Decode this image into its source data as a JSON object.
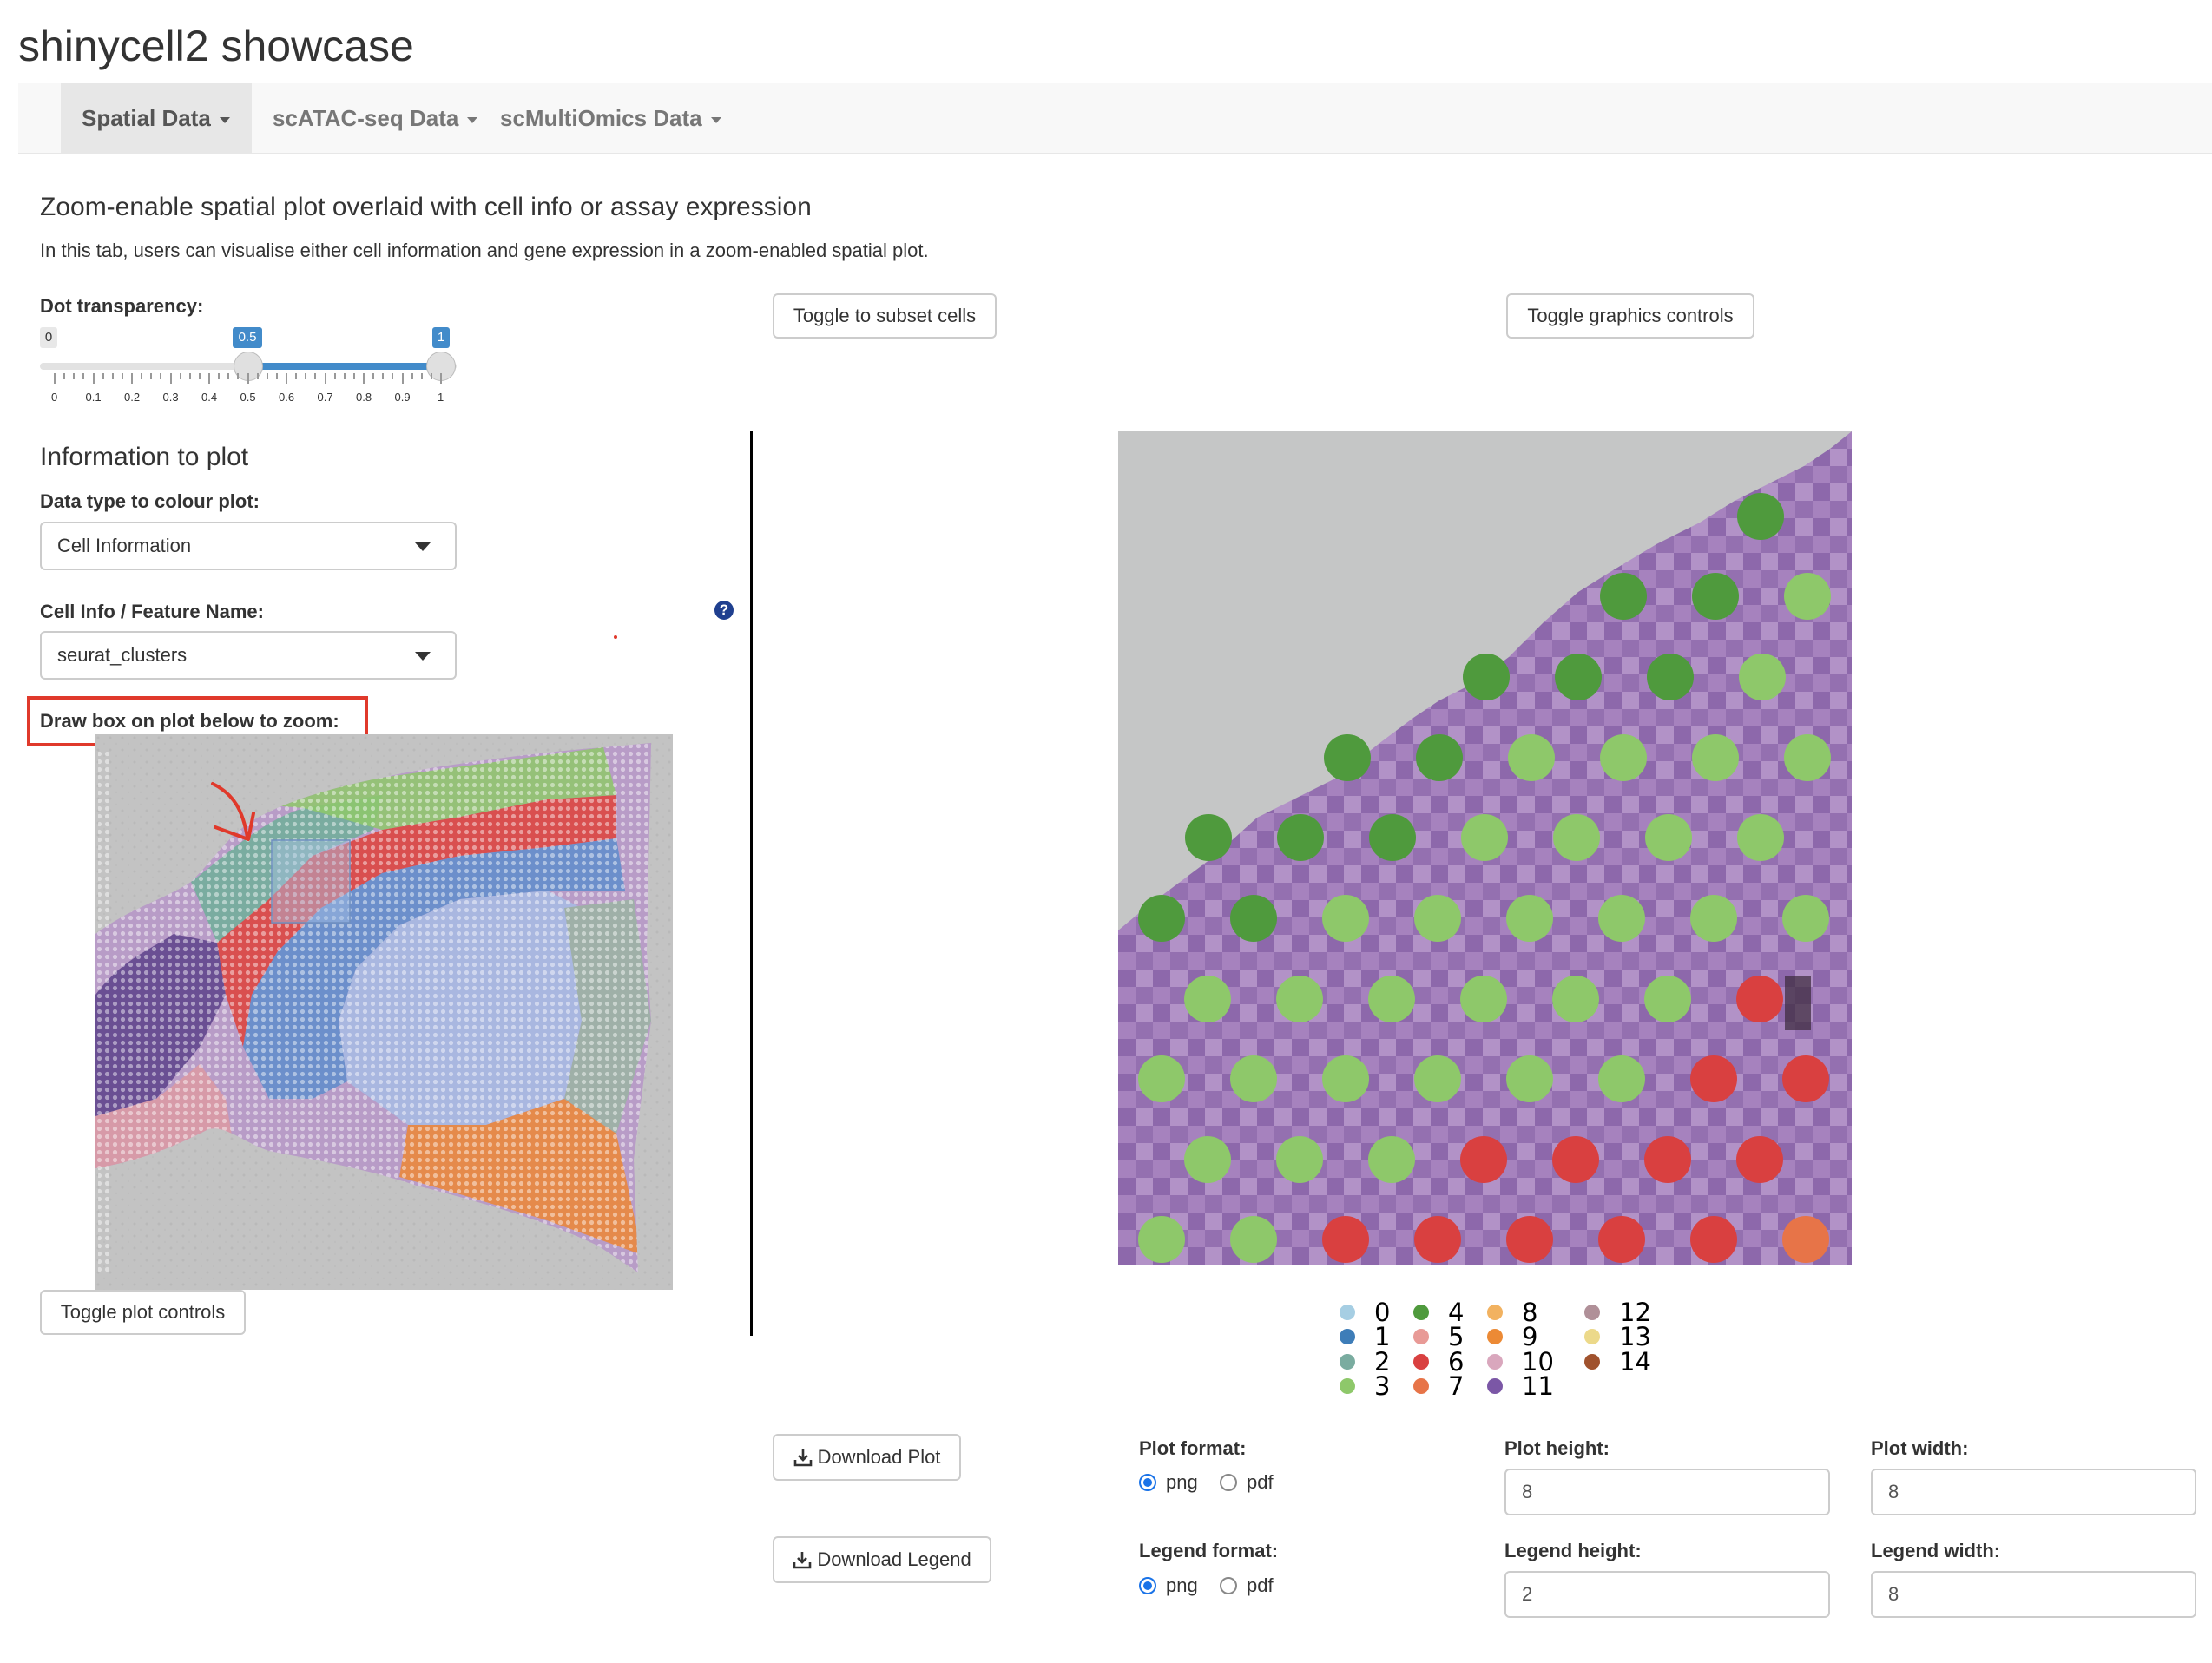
{
  "app": {
    "title": "shinycell2 showcase"
  },
  "nav": {
    "tabs": [
      {
        "label": "Spatial Data",
        "active": true
      },
      {
        "label": "scATAC-seq Data",
        "active": false
      },
      {
        "label": "scMultiOmics Data",
        "active": false
      }
    ]
  },
  "main": {
    "heading": "Zoom-enable spatial plot overlaid with cell info or assay expression",
    "description": "In this tab, users can visualise either cell information and gene expression in a zoom-enabled spatial plot."
  },
  "controls": {
    "transparency_label": "Dot transparency:",
    "slider": {
      "min_label": "0",
      "low_label": "0.5",
      "high_label": "1",
      "min": 0,
      "max": 1,
      "low": 0.5,
      "high": 1,
      "ticks": [
        "0",
        "0.1",
        "0.2",
        "0.3",
        "0.4",
        "0.5",
        "0.6",
        "0.7",
        "0.8",
        "0.9",
        "1"
      ]
    },
    "toggle_subset_label": "Toggle to subset cells",
    "toggle_graphics_label": "Toggle graphics controls",
    "info_heading": "Information to plot",
    "data_type_label": "Data type to colour plot:",
    "data_type_value": "Cell Information",
    "feature_label": "Cell Info / Feature Name:",
    "feature_value": "seurat_clusters",
    "help_icon_text": "?",
    "draw_box_label": "Draw box on plot below to zoom:",
    "toggle_plot_controls_label": "Toggle plot controls"
  },
  "legend": {
    "items": [
      {
        "label": "0",
        "color": "#a6cee3"
      },
      {
        "label": "1",
        "color": "#3e7db8"
      },
      {
        "label": "2",
        "color": "#7aaca0"
      },
      {
        "label": "3",
        "color": "#8ec86a"
      },
      {
        "label": "4",
        "color": "#4f9a3d"
      },
      {
        "label": "5",
        "color": "#e89a96"
      },
      {
        "label": "6",
        "color": "#d94040"
      },
      {
        "label": "7",
        "color": "#e77448"
      },
      {
        "label": "8",
        "color": "#f2b260"
      },
      {
        "label": "9",
        "color": "#ec8a35"
      },
      {
        "label": "10",
        "color": "#d9a7bd"
      },
      {
        "label": "11",
        "color": "#7b57a6"
      },
      {
        "label": "12",
        "color": "#b09098"
      },
      {
        "label": "13",
        "color": "#ecd98a"
      },
      {
        "label": "14",
        "color": "#a0522d"
      }
    ]
  },
  "downloads": {
    "plot_button": "Download Plot",
    "legend_button": "Download Legend",
    "plot_format_label": "Plot format:",
    "plot_height_label": "Plot height:",
    "plot_width_label": "Plot width:",
    "plot_height_value": "8",
    "plot_width_value": "8",
    "legend_format_label": "Legend format:",
    "legend_height_label": "Legend height:",
    "legend_width_label": "Legend width:",
    "legend_height_value": "2",
    "legend_width_value": "8",
    "opt_png": "png",
    "opt_pdf": "pdf",
    "plot_format_selected": "png",
    "legend_format_selected": "png"
  },
  "colors": {
    "navbar_bg": "#f8f8f8",
    "accent": "#428bca",
    "annotation_red": "#e0392b",
    "tissue_purple": "#9a6fb6",
    "slide_background": "#c3c3c3"
  }
}
